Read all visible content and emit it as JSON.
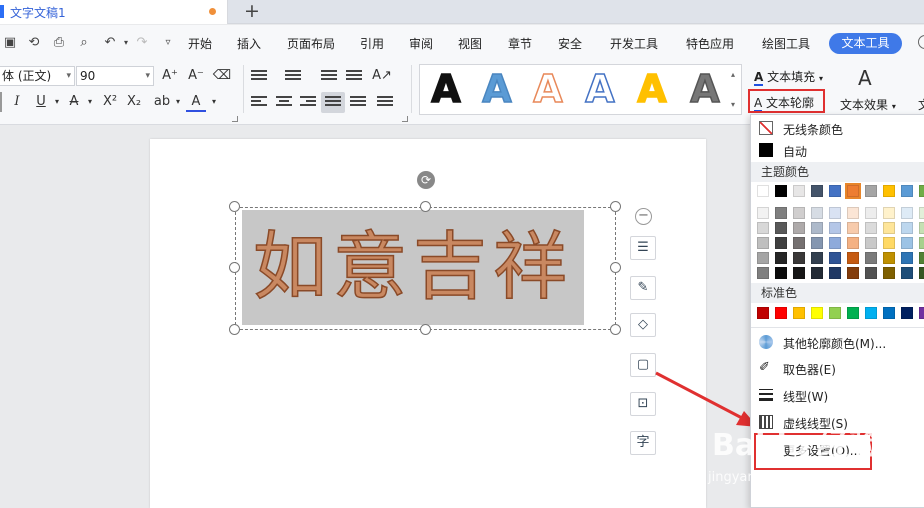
{
  "tab": {
    "doc_title": "文字文稿1",
    "new_tab": "+"
  },
  "menu": {
    "items": [
      "开始",
      "插入",
      "页面布局",
      "引用",
      "审阅",
      "视图",
      "章节",
      "安全",
      "开发工具",
      "特色应用",
      "绘图工具"
    ],
    "active": "文本工具"
  },
  "ribbon": {
    "font_name": "体 (正文)",
    "font_size": "90",
    "grow_font": "A⁺",
    "shrink_font": "A⁻",
    "text_fill_label": "文本填充",
    "text_outline_label": "文本轮廓",
    "text_effect_label": "文本效果",
    "partial_label": "文"
  },
  "gallery": {
    "styles": [
      {
        "letter": "A",
        "color": "#111111",
        "outline": "#111111"
      },
      {
        "letter": "A",
        "color": "#5b9bd5",
        "outline": "#4a86c0"
      },
      {
        "letter": "A",
        "color": "#ffffff",
        "outline": "#e8895a"
      },
      {
        "letter": "A",
        "color": "#ffffff",
        "outline": "#4472c4"
      },
      {
        "letter": "A",
        "color": "#ffc000",
        "outline": "#ffc000"
      },
      {
        "letter": "A",
        "color": "#777777",
        "outline": "#555555"
      }
    ]
  },
  "canvas": {
    "wordart_text": "如意吉祥"
  },
  "dropdown": {
    "no_line": "无线条颜色",
    "auto": "自动",
    "theme_colors_label": "主题颜色",
    "standard_colors_label": "标准色",
    "more_colors": "其他轮廓颜色(M)...",
    "eyedropper": "取色器(E)",
    "line_type": "线型(W)",
    "dash_type": "虚线线型(S)",
    "more_settings": "更多设置(O)..."
  },
  "theme_colors_top": [
    "#ffffff",
    "#000000",
    "#e7e6e6",
    "#44546a",
    "#4472c4",
    "#ed7d31",
    "#a5a5a5",
    "#ffc000",
    "#5b9bd5",
    "#70ad47"
  ],
  "theme_colors_shades": [
    [
      "#f2f2f2",
      "#7f7f7f",
      "#d0cece",
      "#d6dce4",
      "#d9e2f3",
      "#fbe5d5",
      "#ededed",
      "#fff2cc",
      "#deebf6",
      "#e2efd9"
    ],
    [
      "#d8d8d8",
      "#595959",
      "#aeaaaa",
      "#adb9ca",
      "#b4c6e7",
      "#f7cbac",
      "#dbdbdb",
      "#fee599",
      "#bdd7ee",
      "#c5e0b3"
    ],
    [
      "#bfbfbf",
      "#3f3f3f",
      "#757070",
      "#8496b0",
      "#8eaadb",
      "#f4b183",
      "#c9c9c9",
      "#ffd965",
      "#9cc3e5",
      "#a8d08d"
    ],
    [
      "#a5a5a5",
      "#262626",
      "#3a3838",
      "#323f4f",
      "#2f5496",
      "#c55a11",
      "#7b7b7b",
      "#bf9000",
      "#2e75b5",
      "#538135"
    ],
    [
      "#7f7f7f",
      "#0c0c0c",
      "#171616",
      "#222a35",
      "#1f3864",
      "#833c0b",
      "#525252",
      "#7f6000",
      "#1e4e79",
      "#375623"
    ]
  ],
  "standard_colors": [
    "#c00000",
    "#ff0000",
    "#ffc000",
    "#ffff00",
    "#92d050",
    "#00b050",
    "#00b0f0",
    "#0070c0",
    "#002060",
    "#7030a0"
  ],
  "watermark": {
    "brand": "Baidu 经验",
    "url": "jingyan.baidu.com"
  }
}
